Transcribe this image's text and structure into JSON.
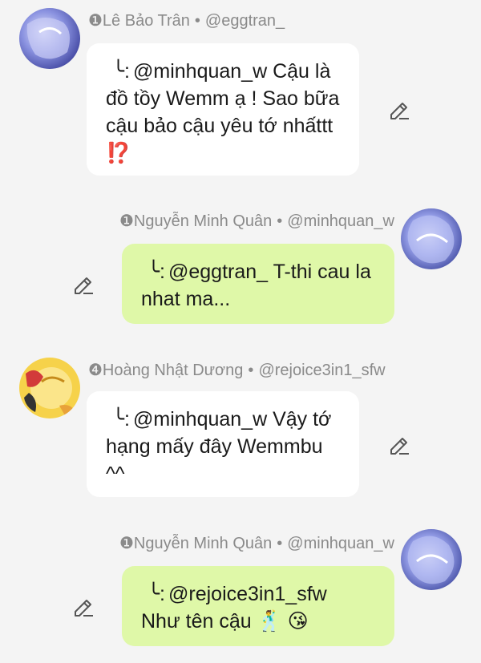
{
  "messages": [
    {
      "side": "left",
      "name": "❶Lê Bảo Trân",
      "separator": "•",
      "handle": "@eggtran_",
      "reply_mark": "╰:",
      "text": "@minhquan_w Cậu là đồ tồy Wemm ạ ! Sao bữa cậu bảo cậu yêu tớ nhấttt ⁉️",
      "bubble_color": "#ffffff",
      "avatar_icon": "avatar-blue-anime-icon"
    },
    {
      "side": "right",
      "name": "❶Nguyễn Minh Quân",
      "separator": "•",
      "handle": "@minhquan_w",
      "reply_mark": "╰:",
      "text": "@eggtran_ T-thi cau la nhat ma...",
      "bubble_color": "#dff8a8",
      "avatar_icon": "avatar-blue-anime-icon"
    },
    {
      "side": "left",
      "name": "❹Hoàng Nhật Dương",
      "separator": "•",
      "handle": "@rejoice3in1_sfw",
      "reply_mark": "╰:",
      "text": "@minhquan_w Vậy tớ hạng mấy đây Wemmbu ^^",
      "bubble_color": "#ffffff",
      "avatar_icon": "avatar-yellow-anime-icon"
    },
    {
      "side": "right",
      "name": "❶Nguyễn Minh Quân",
      "separator": "•",
      "handle": "@minhquan_w",
      "reply_mark": "╰:",
      "text_line1": "@rejoice3in1_sfw",
      "text_line2": "Như tên cậu 🕺 😘",
      "bubble_color": "#dff8a8",
      "avatar_icon": "avatar-blue-anime-icon"
    }
  ],
  "colors": {
    "background": "#f4f4f4",
    "header_text": "#8a8a8a",
    "green_bubble": "#dff8a8",
    "white_bubble": "#ffffff"
  }
}
